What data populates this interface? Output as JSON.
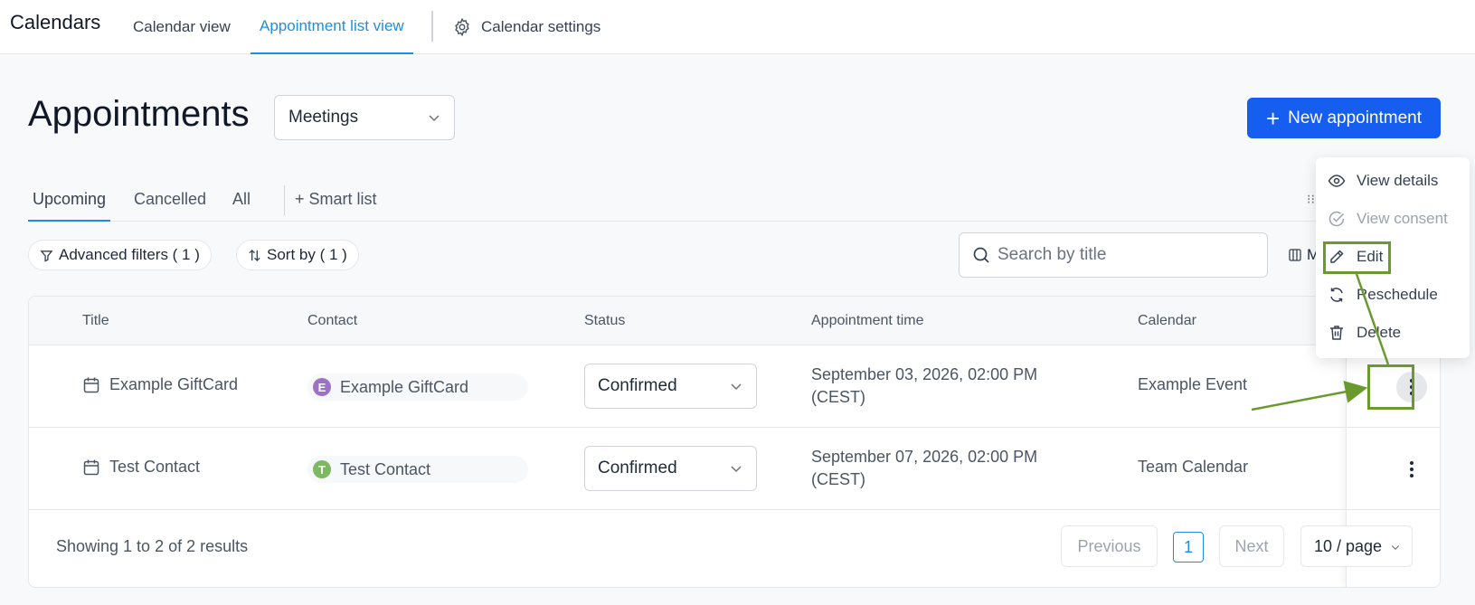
{
  "topbar": {
    "brand": "Calendars",
    "nav": [
      "Calendar view",
      "Appointment list view"
    ],
    "settings": "Calendar settings"
  },
  "header": {
    "title": "Appointments",
    "dropdown_value": "Meetings",
    "new_button": "New appointment"
  },
  "tabs": [
    "Upcoming",
    "Cancelled",
    "All"
  ],
  "smart_list": "+ Smart list",
  "filters": {
    "advanced": "Advanced filters ( 1 )",
    "sort": "Sort by ( 1 )",
    "search_placeholder": "Search by title",
    "manage_partial": "M"
  },
  "table": {
    "columns": [
      "Title",
      "Contact",
      "Status",
      "Appointment time",
      "Calendar"
    ],
    "rows": [
      {
        "title": "Example GiftCard",
        "contact": "Example GiftCard",
        "contact_initial": "E",
        "avatar_color": "#9b72c7",
        "status": "Confirmed",
        "time_line1": "September 03, 2026, 02:00 PM",
        "time_line2": "(CEST)",
        "calendar": "Example Event"
      },
      {
        "title": "Test Contact",
        "contact": "Test Contact",
        "contact_initial": "T",
        "avatar_color": "#7cb862",
        "status": "Confirmed",
        "time_line1": "September 07, 2026, 02:00 PM",
        "time_line2": "(CEST)",
        "calendar": "Team Calendar"
      }
    ]
  },
  "footer": {
    "showing": "Showing 1 to 2 of 2 results",
    "previous": "Previous",
    "page": "1",
    "next": "Next",
    "per_page": "10 / page"
  },
  "menu": {
    "items": [
      "View details",
      "View consent",
      "Edit",
      "Reschedule",
      "Delete"
    ]
  },
  "colors": {
    "accent": "#155eef",
    "tab_active": "#1d8fe0",
    "annotation": "#6a9a2e"
  }
}
